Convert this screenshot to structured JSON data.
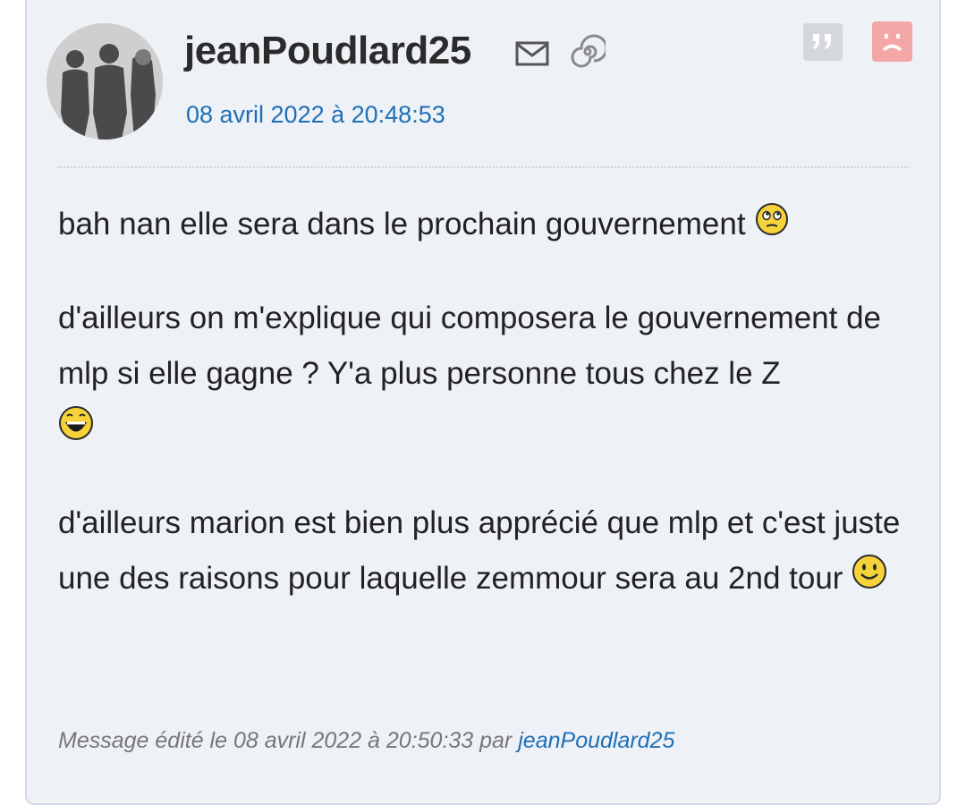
{
  "post": {
    "username": "jeanPoudlard25",
    "date": "08 avril 2022 à 20:48:53",
    "paragraphs": [
      {
        "text": "bah nan elle sera dans le prochain gouvernement",
        "smiley": "rolling-eyes-smiley-icon"
      },
      {
        "text": "d'ailleurs on m'explique qui composera le gouvernement de mlp si elle gagne ? Y'a plus personne tous chez le Z",
        "smiley": "laughing-smiley-icon"
      },
      {
        "text": "d'ailleurs marion est bien plus apprécié que mlp et c'est juste une des raisons pour laquelle zemmour sera au 2nd tour",
        "smiley": "happy-smiley-icon"
      }
    ],
    "edit_note_prefix": "Message édité le 08 avril 2022 à 20:50:33 par",
    "edit_note_author": "jeanPoudlard25"
  },
  "icons": {
    "mail": "mail-icon",
    "spiral": "spiral-icon",
    "quote": "quote-icon",
    "report": "report-icon"
  },
  "colors": {
    "card_background": "#eef1f6",
    "link_blue": "#1f6fb7",
    "report_red": "#f3a7a7",
    "quote_gray": "#d4d7dc"
  }
}
